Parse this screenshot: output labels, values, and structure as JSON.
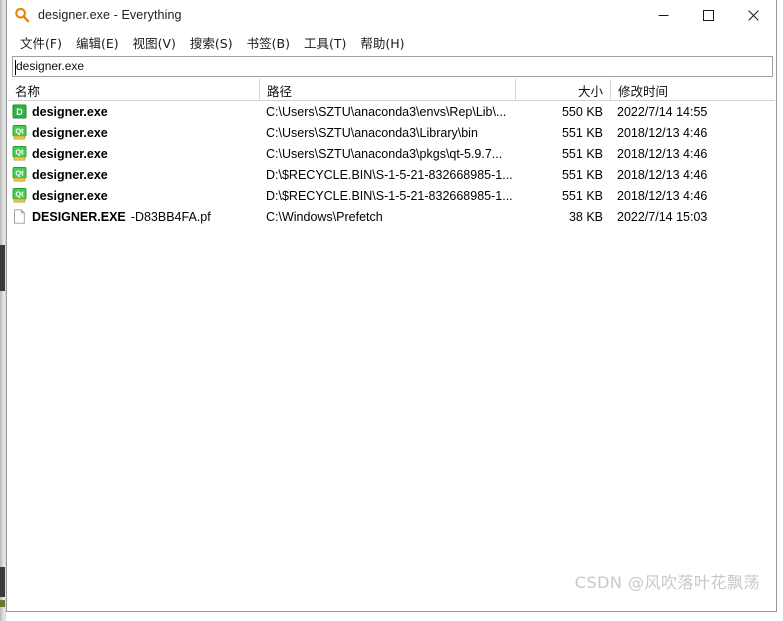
{
  "window": {
    "title": "designer.exe - Everything",
    "app_icon": "magnifier-icon",
    "controls": {
      "minimize_label": "—",
      "maximize_label": "□",
      "close_label": "✕"
    }
  },
  "menubar": {
    "items": [
      {
        "label": "文件(F)",
        "text": "文件",
        "mnemonic": "F",
        "name": "menu-file"
      },
      {
        "label": "编辑(E)",
        "text": "编辑",
        "mnemonic": "E",
        "name": "menu-edit"
      },
      {
        "label": "视图(V)",
        "text": "视图",
        "mnemonic": "V",
        "name": "menu-view"
      },
      {
        "label": "搜索(S)",
        "text": "搜索",
        "mnemonic": "S",
        "name": "menu-search"
      },
      {
        "label": "书签(B)",
        "text": "书签",
        "mnemonic": "B",
        "name": "menu-bookmarks"
      },
      {
        "label": "工具(T)",
        "text": "工具",
        "mnemonic": "T",
        "name": "menu-tools"
      },
      {
        "label": "帮助(H)",
        "text": "帮助",
        "mnemonic": "H",
        "name": "menu-help"
      }
    ]
  },
  "search": {
    "value": "designer.exe",
    "placeholder": ""
  },
  "columns": [
    {
      "key": "name",
      "label": "名称"
    },
    {
      "key": "path",
      "label": "路径"
    },
    {
      "key": "size",
      "label": "大小"
    },
    {
      "key": "date",
      "label": "修改时间"
    }
  ],
  "rows": [
    {
      "icon": "qt-designer-icon",
      "name": "designer.exe",
      "name_suffix": "",
      "path": "C:\\Users\\SZTU\\anaconda3\\envs\\Rep\\Lib\\...",
      "size": "550 KB",
      "date": "2022/7/14 14:55"
    },
    {
      "icon": "qt-app-icon",
      "name": "designer.exe",
      "name_suffix": "",
      "path": "C:\\Users\\SZTU\\anaconda3\\Library\\bin",
      "size": "551 KB",
      "date": "2018/12/13 4:46"
    },
    {
      "icon": "qt-app-icon",
      "name": "designer.exe",
      "name_suffix": "",
      "path": "C:\\Users\\SZTU\\anaconda3\\pkgs\\qt-5.9.7...",
      "size": "551 KB",
      "date": "2018/12/13 4:46"
    },
    {
      "icon": "qt-app-icon",
      "name": "designer.exe",
      "name_suffix": "",
      "path": "D:\\$RECYCLE.BIN\\S-1-5-21-832668985-1...",
      "size": "551 KB",
      "date": "2018/12/13 4:46"
    },
    {
      "icon": "qt-app-icon",
      "name": "designer.exe",
      "name_suffix": "",
      "path": "D:\\$RECYCLE.BIN\\S-1-5-21-832668985-1...",
      "size": "551 KB",
      "date": "2018/12/13 4:46"
    },
    {
      "icon": "generic-file-icon",
      "name": "DESIGNER.EXE",
      "name_suffix": "-D83BB4FA.pf",
      "path": "C:\\Windows\\Prefetch",
      "size": "38 KB",
      "date": "2022/7/14 15:03"
    }
  ],
  "watermark": {
    "text": "CSDN @风吹落叶花飘荡"
  },
  "colors": {
    "accent_icon": "#e8820c",
    "qt_green": "#41cd52",
    "qt_yellow": "#e8c84a",
    "window_border": "#9a9a9a",
    "header_sep": "#d7d7d7",
    "watermark": "#c8c8c8"
  }
}
